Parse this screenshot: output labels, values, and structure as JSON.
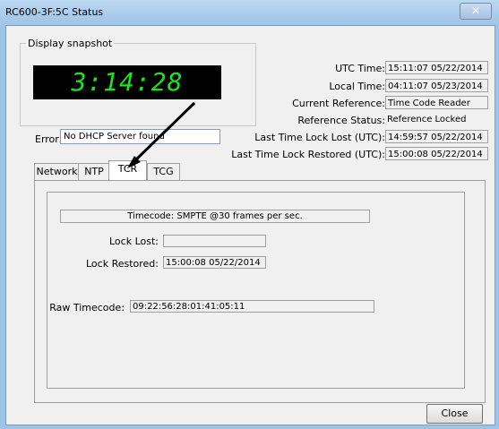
{
  "window": {
    "title": "RC600-3F:5C Status",
    "close_glyph": "✕"
  },
  "snapshot": {
    "label": "Display snapshot",
    "clock": "3:14:28",
    "clock_color": "#19e619"
  },
  "status": {
    "rows": [
      {
        "label": "UTC Time:",
        "value": "15:11:07 05/22/2014"
      },
      {
        "label": "Local Time:",
        "value": "04:11:07 05/23/2014"
      },
      {
        "label": "Current Reference:",
        "value": "Time Code Reader"
      },
      {
        "label": "Reference Status:",
        "value": "Reference Locked"
      },
      {
        "label": "Last Time Lock Lost (UTC):",
        "value": "14:59:57 05/22/2014"
      },
      {
        "label": "Last Time Lock Restored (UTC):",
        "value": "15:00:08 05/22/2014"
      }
    ]
  },
  "error": {
    "label": "Error:",
    "value": "No DHCP Server found"
  },
  "tabs": [
    {
      "label": "Network"
    },
    {
      "label": "NTP"
    },
    {
      "label": "TCR",
      "active": true
    },
    {
      "label": "TCG"
    }
  ],
  "tcr": {
    "timecode_info": "Timecode: SMPTE  @30 frames per sec.",
    "lock_lost_label": "Lock Lost:",
    "lock_lost_value": "",
    "lock_restored_label": "Lock Restored:",
    "lock_restored_value": "15:00:08 05/22/2014",
    "raw_label": "Raw Timecode:",
    "raw_value": "09:22:56:28:01:41:05:11"
  },
  "buttons": {
    "close": "Close"
  }
}
